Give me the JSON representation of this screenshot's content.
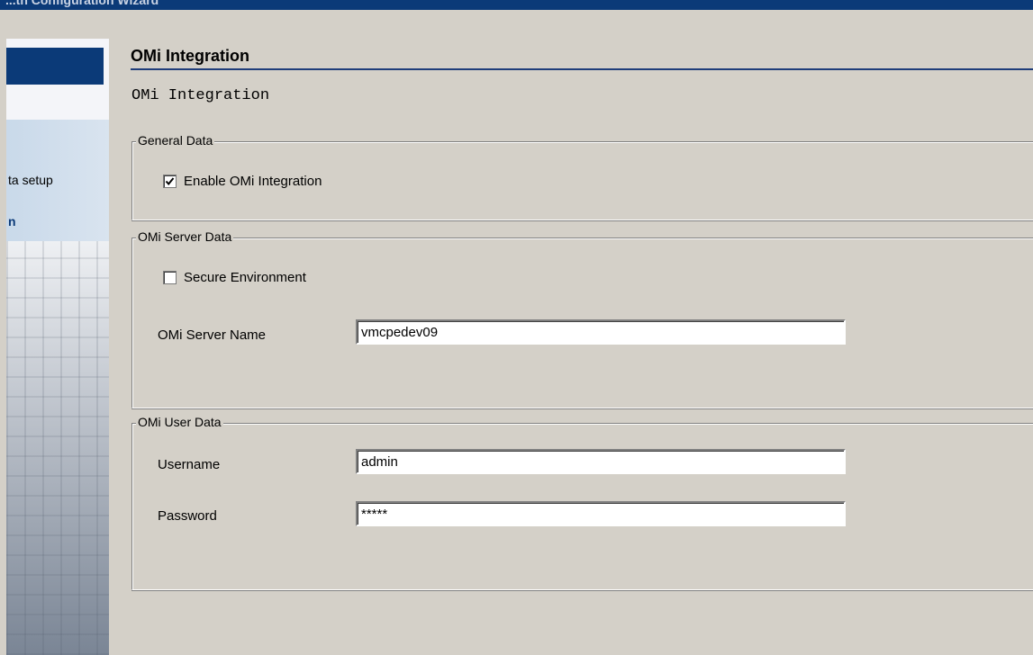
{
  "window": {
    "title": "...th Configuration Wizard"
  },
  "sidebar": {
    "items": [
      {
        "label": "ta setup",
        "state": "completed"
      },
      {
        "label": "n",
        "state": "current"
      }
    ]
  },
  "page": {
    "header": "OMi Integration",
    "subtitle": "OMi Integration"
  },
  "general_data": {
    "legend": "General Data",
    "enable_integration": {
      "label": "Enable OMi Integration",
      "checked": true
    }
  },
  "server_data": {
    "legend": "OMi Server Data",
    "secure_environment": {
      "label": "Secure Environment",
      "checked": false
    },
    "server_name": {
      "label": "OMi Server Name",
      "value": "vmcpedev09"
    }
  },
  "user_data": {
    "legend": "OMi User Data",
    "username": {
      "label": "Username",
      "value": "admin"
    },
    "password": {
      "label": "Password",
      "value": "*****"
    }
  },
  "colors": {
    "background": "#d4d0c8",
    "accent": "#0b3a78"
  }
}
